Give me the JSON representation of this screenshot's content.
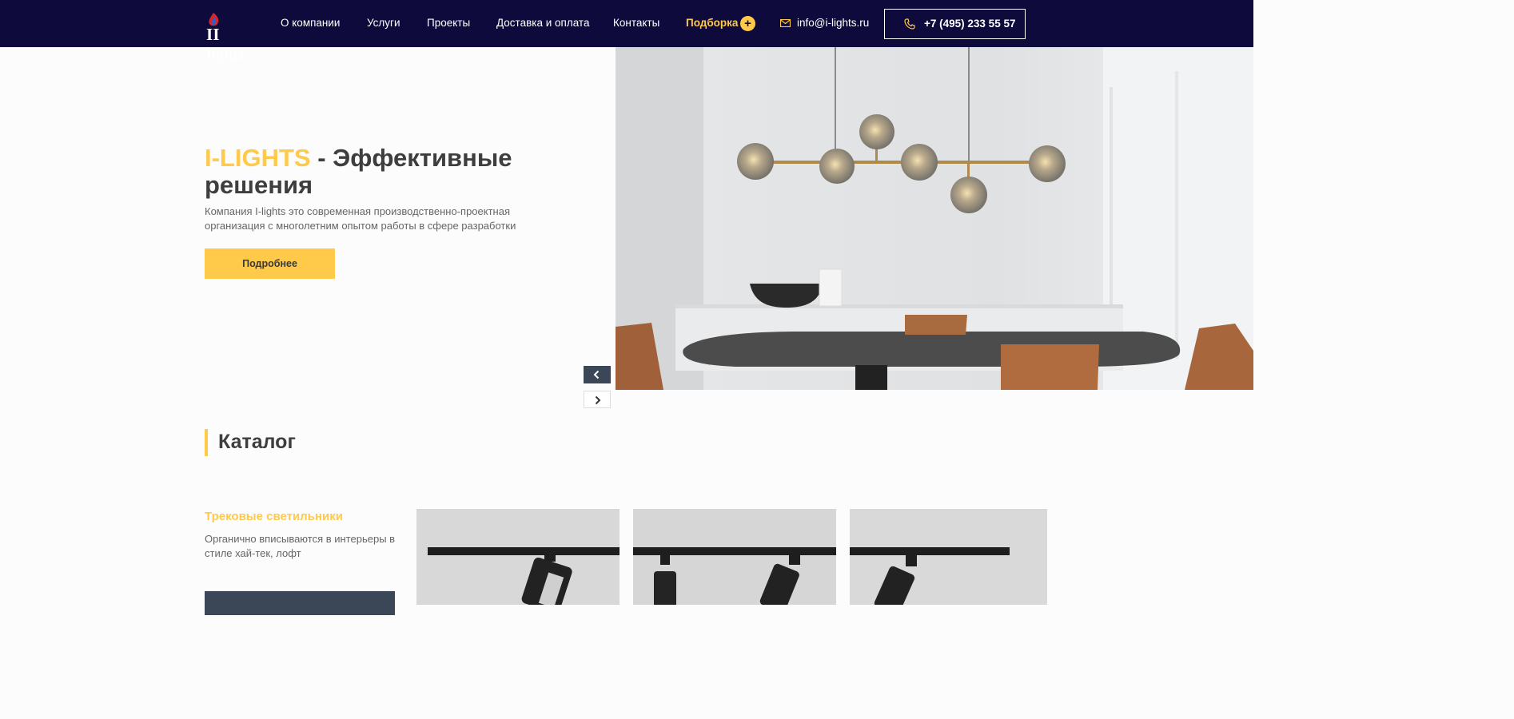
{
  "header": {
    "logo_text": "lights",
    "nav": [
      {
        "label": "О компании"
      },
      {
        "label": "Услуги"
      },
      {
        "label": "Проекты"
      },
      {
        "label": "Доставка и оплата"
      },
      {
        "label": "Контакты"
      },
      {
        "label": "Подборка"
      }
    ],
    "plus": "+",
    "email": "info@i-lights.ru",
    "phone": "+7 (495) 233 55 57"
  },
  "hero": {
    "brand": "I-LIGHTS",
    "title_rest": " - Эффективные решения",
    "description": "Компания I-lights это современная производственно-проектная организация с многолетним опытом работы в сфере разработки",
    "button": "Подробнее"
  },
  "catalog": {
    "title": "Каталог",
    "category_name": "Трековые светильники",
    "category_desc": "Органично вписываются в интерьеры в стиле хай-тек, лофт"
  },
  "colors": {
    "header_bg": "#0f0a3c",
    "accent": "#ffc94a",
    "dark_button": "#3b4656"
  }
}
